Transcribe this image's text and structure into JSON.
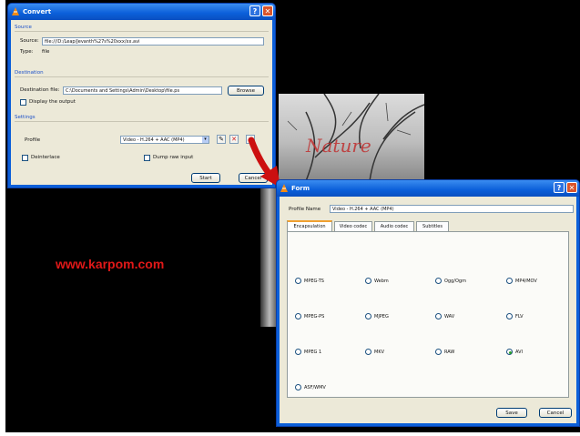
{
  "watermark": "www.karpom.com",
  "photo_text": "Nature",
  "convert_dialog": {
    "title": "Convert",
    "source_group": "Source",
    "source_label": "Source:",
    "source_value": "file:///D:/Leap/Jevanth%27s%20xxx/xx.avi",
    "type_label": "Type:",
    "type_value": "file",
    "destination_group": "Destination",
    "destination_file_label": "Destination file:",
    "destination_file_value": "C:\\Documents and Settings\\Admin\\Desktop\\file.ps",
    "browse_label": "Browse",
    "display_output_label": "Display the output",
    "settings_group": "Settings",
    "profile_label": "Profile",
    "profile_value": "Video - H.264 + AAC (MP4)",
    "deinterlace_label": "Deinterlace",
    "dump_raw_label": "Dump raw input",
    "start_label": "Start",
    "cancel_label": "Cancel"
  },
  "form_dialog": {
    "title": "Form",
    "profile_name_label": "Profile Name",
    "profile_name_value": "Video - H.264 + AAC (MP4)",
    "tabs": [
      "Encapsulation",
      "Video codec",
      "Audio codec",
      "Subtitles"
    ],
    "active_tab": 0,
    "options": [
      {
        "label": "MPEG-TS",
        "checked": false
      },
      {
        "label": "Webm",
        "checked": false
      },
      {
        "label": "Ogg/Ogm",
        "checked": false
      },
      {
        "label": "MP4/MOV",
        "checked": false
      },
      {
        "label": "MPEG-PS",
        "checked": false
      },
      {
        "label": "MJPEG",
        "checked": false
      },
      {
        "label": "WAV",
        "checked": false
      },
      {
        "label": "FLV",
        "checked": false
      },
      {
        "label": "MPEG 1",
        "checked": false
      },
      {
        "label": "MKV",
        "checked": false
      },
      {
        "label": "RAW",
        "checked": false
      },
      {
        "label": "AVI",
        "checked": true
      },
      {
        "label": "ASF/WMV",
        "checked": false
      }
    ],
    "save_label": "Save",
    "cancel_label": "Cancel"
  },
  "colors": {
    "titlebar": "#0b5fd9",
    "dialog_bg": "#ece9d8",
    "watermark": "#e01818",
    "arrow": "#cc1010"
  }
}
